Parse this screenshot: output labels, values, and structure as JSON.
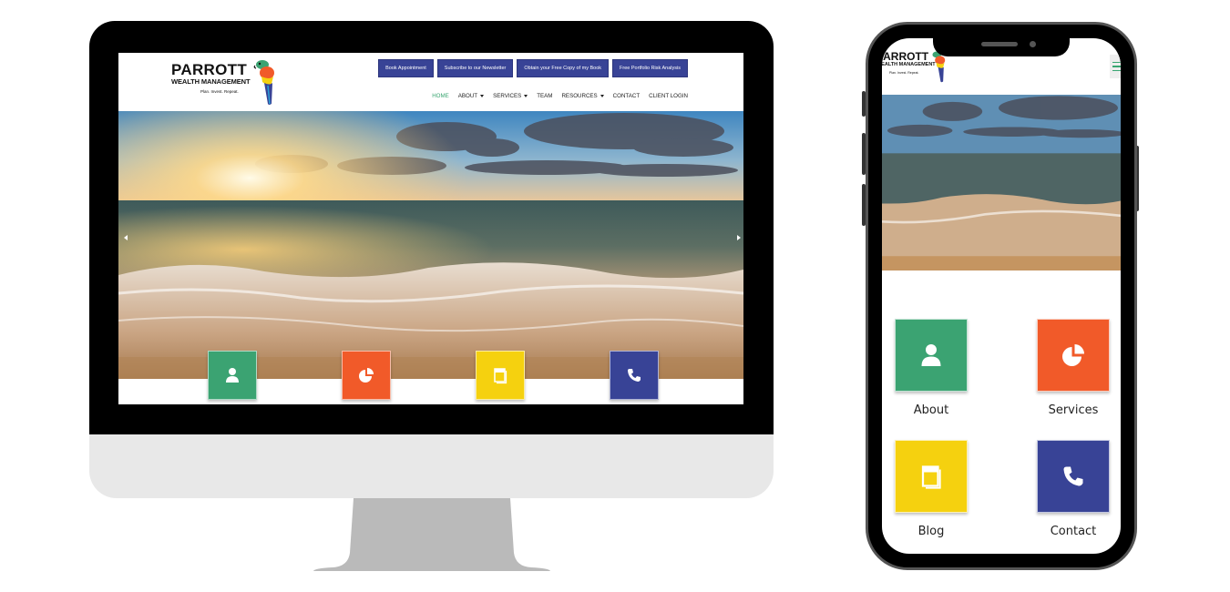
{
  "site": {
    "brand": {
      "name_line1": "PARROTT",
      "name_line2": "WEALTH MANAGEMENT",
      "tagline": "Plan. Invest. Repeat."
    },
    "cta_buttons": [
      {
        "label": "Book Appointment"
      },
      {
        "label": "Subscribe to our Newsletter"
      },
      {
        "label": "Obtain your Free Copy of my Book"
      },
      {
        "label": "Free Portfolio Risk Analysis"
      }
    ],
    "nav": [
      {
        "label": "HOME",
        "active": true,
        "dropdown": false
      },
      {
        "label": "ABOUT",
        "active": false,
        "dropdown": true
      },
      {
        "label": "SERVICES",
        "active": false,
        "dropdown": true
      },
      {
        "label": "TEAM",
        "active": false,
        "dropdown": false
      },
      {
        "label": "RESOURCES",
        "active": false,
        "dropdown": true
      },
      {
        "label": "CONTACT",
        "active": false,
        "dropdown": false
      },
      {
        "label": "CLIENT LOGIN",
        "active": false,
        "dropdown": false
      }
    ],
    "hero": {
      "image": "sunset-ocean-waves-beach",
      "prev_icon": "arrow-left-icon",
      "next_icon": "arrow-right-icon"
    },
    "feature_tiles": [
      {
        "label": "About",
        "icon": "person-icon",
        "color": "#3ba372"
      },
      {
        "label": "Services",
        "icon": "pie-chart-icon",
        "color": "#f15a29"
      },
      {
        "label": "Blog",
        "icon": "book-icon",
        "color": "#f5d10f"
      },
      {
        "label": "Contact",
        "icon": "phone-icon",
        "color": "#384396"
      }
    ]
  },
  "colors": {
    "accent_green": "#3aa672",
    "cta_blue": "#384396",
    "device_black": "#000000",
    "monitor_chin": "#e8e8e8",
    "monitor_stand": "#bababa"
  }
}
